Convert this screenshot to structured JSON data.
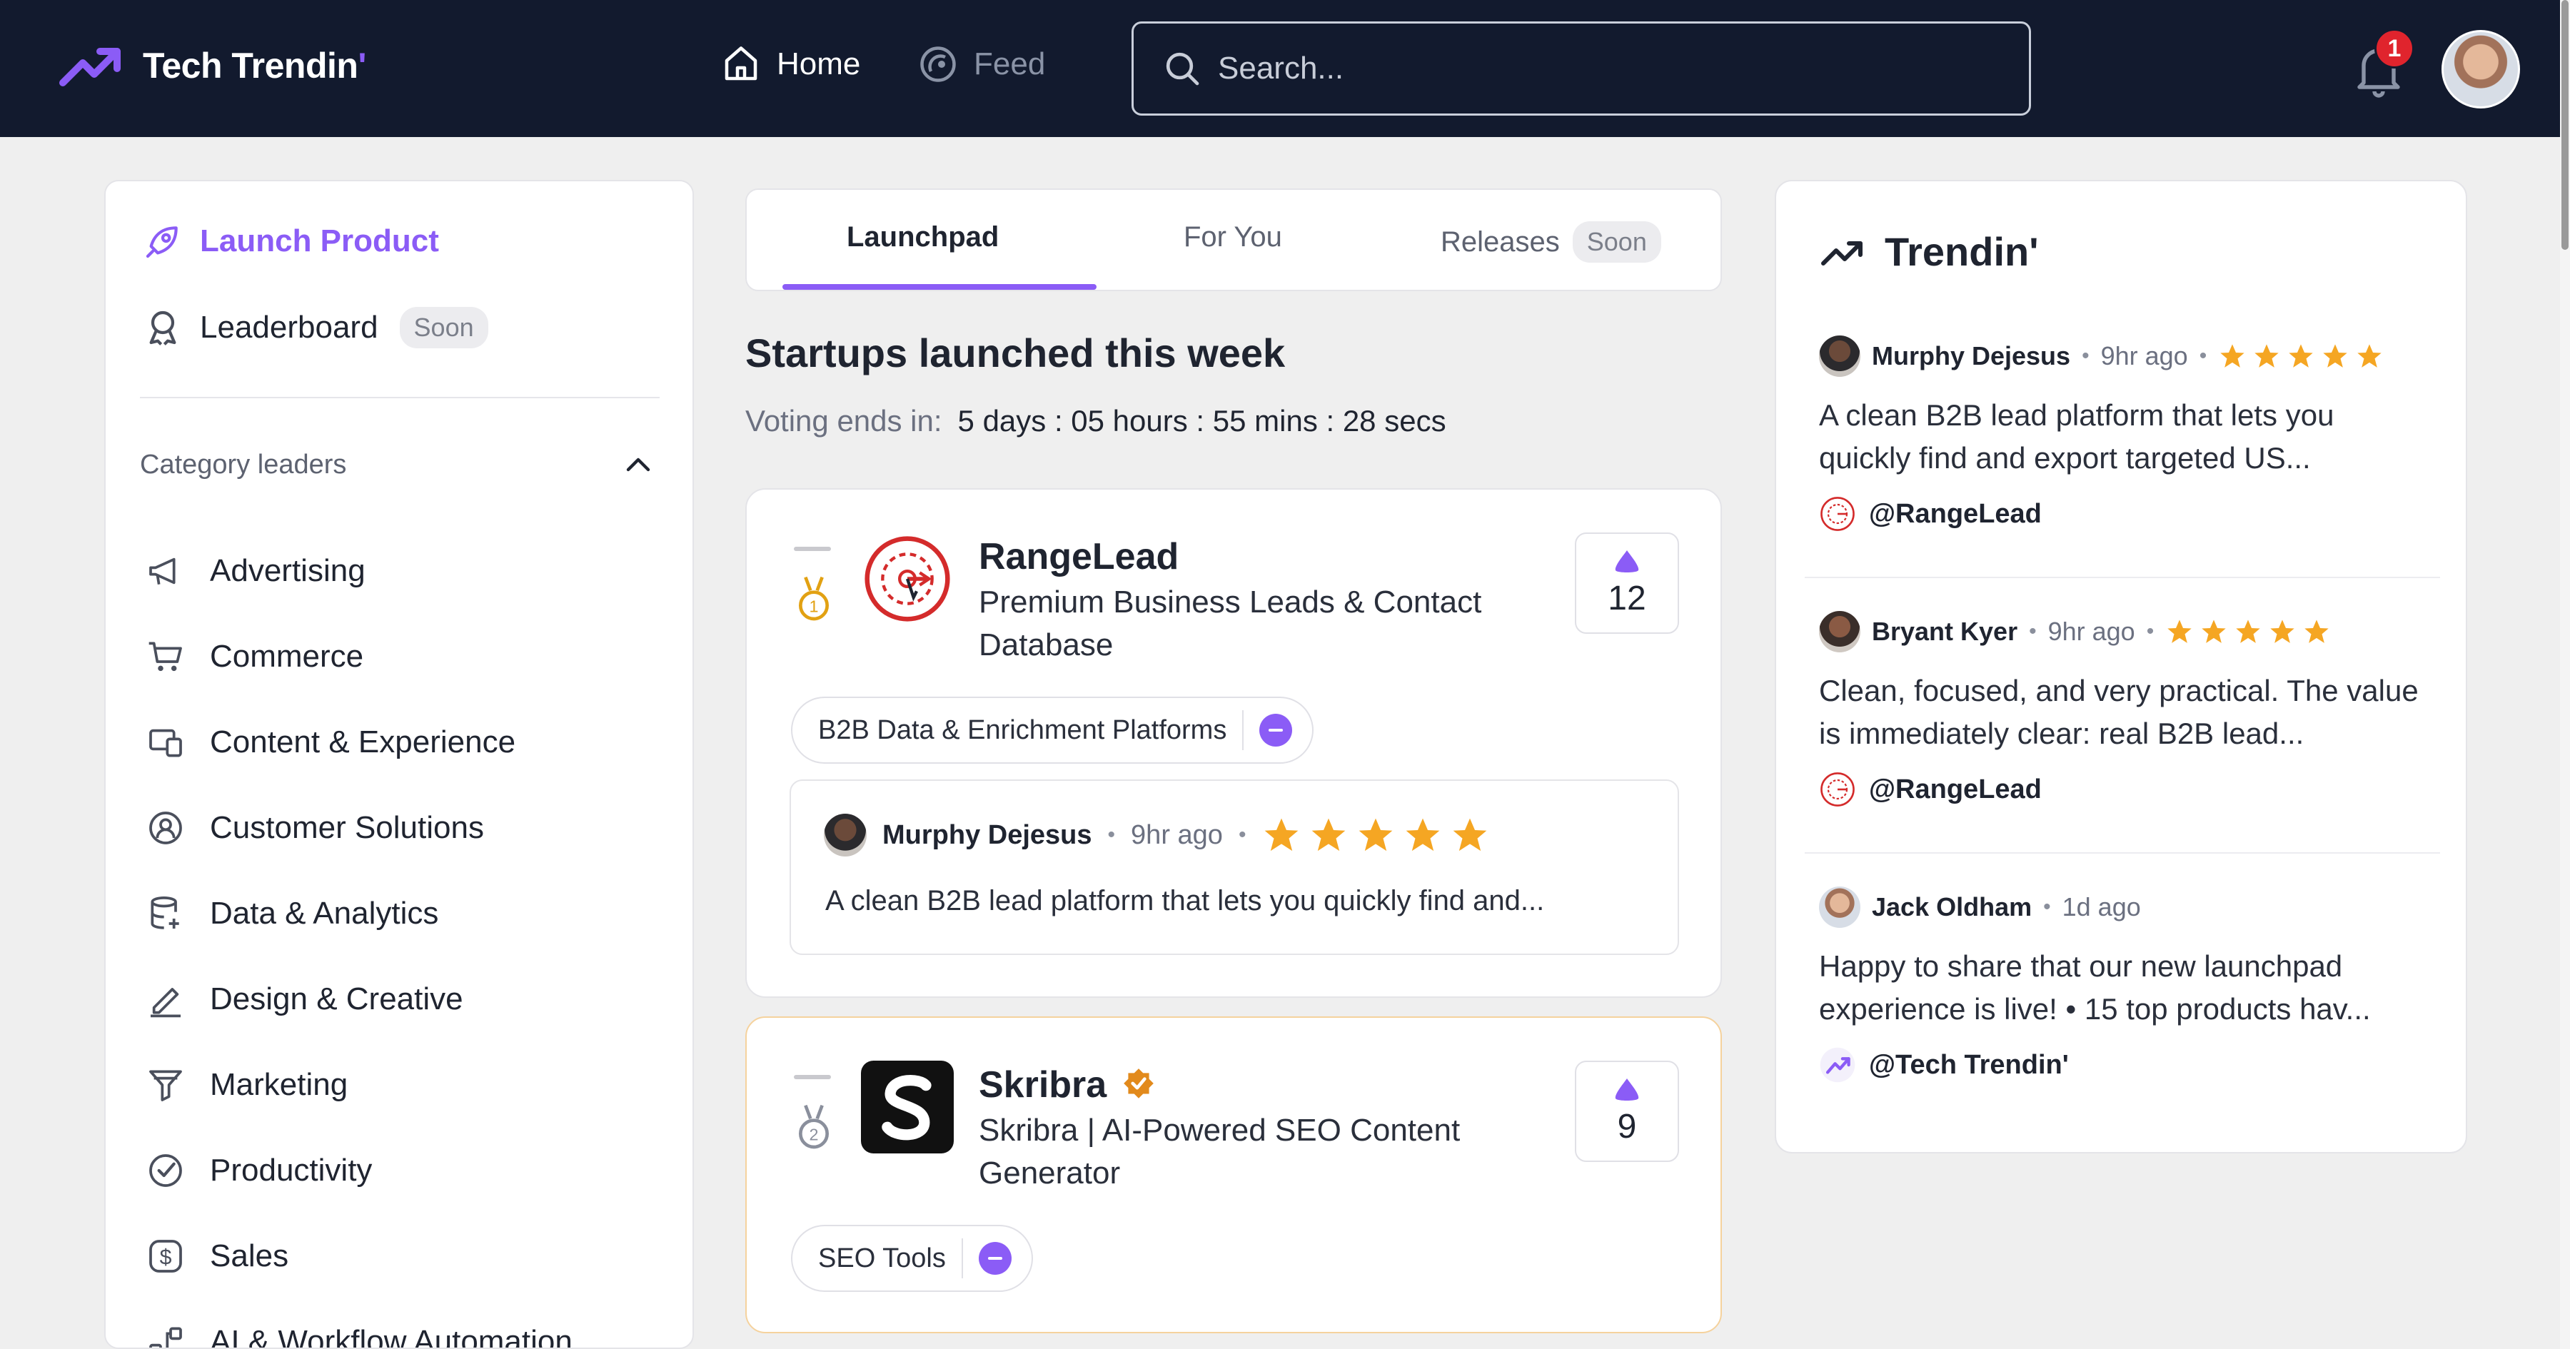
{
  "header": {
    "logo_text": "Tech Trendin",
    "logo_accent": "'",
    "nav": [
      {
        "label": "Home",
        "icon": "home-icon"
      },
      {
        "label": "Feed",
        "icon": "feed-icon"
      }
    ],
    "search_placeholder": "Search...",
    "notification_count": "1"
  },
  "sidebar": {
    "launch_label": "Launch Product",
    "leaderboard_label": "Leaderboard",
    "soon_label": "Soon",
    "categories_title": "Category leaders",
    "categories": [
      {
        "label": "Advertising",
        "icon": "megaphone-icon"
      },
      {
        "label": "Commerce",
        "icon": "cart-icon"
      },
      {
        "label": "Content & Experience",
        "icon": "devices-icon"
      },
      {
        "label": "Customer Solutions",
        "icon": "user-badge-icon"
      },
      {
        "label": "Data & Analytics",
        "icon": "database-icon"
      },
      {
        "label": "Design & Creative",
        "icon": "pencil-icon"
      },
      {
        "label": "Marketing",
        "icon": "funnel-icon"
      },
      {
        "label": "Productivity",
        "icon": "check-circle-icon"
      },
      {
        "label": "Sales",
        "icon": "dollar-icon"
      },
      {
        "label": "AI & Workflow Automation",
        "icon": "workflow-icon"
      }
    ]
  },
  "tabs": {
    "launchpad": "Launchpad",
    "for_you": "For You",
    "releases": "Releases",
    "releases_badge": "Soon"
  },
  "main": {
    "section_title": "Startups launched this week",
    "voting_label": "Voting ends in:",
    "voting_timer": "5 days : 05 hours : 55 mins : 28 secs",
    "products": [
      {
        "name": "RangeLead",
        "tagline": "Premium Business Leads & Contact Database",
        "votes": "12",
        "rank": 1,
        "tag": "B2B Data & Enrichment Platforms",
        "review": {
          "author": "Murphy Dejesus",
          "time": "9hr ago",
          "rating": 5,
          "text": "A clean B2B lead platform that lets you quickly find and..."
        }
      },
      {
        "name": "Skribra",
        "tagline": "Skribra | AI-Powered SEO Content Generator",
        "votes": "9",
        "rank": 2,
        "tag": "SEO Tools",
        "verified": true
      }
    ]
  },
  "trending": {
    "title": "Trendin'",
    "items": [
      {
        "author": "Murphy Dejesus",
        "time": "9hr ago",
        "rating": 5,
        "text": "A clean B2B lead platform that lets you quickly find and export targeted US...",
        "handle": "@RangeLead"
      },
      {
        "author": "Bryant Kyer",
        "time": "9hr ago",
        "rating": 5,
        "text": "Clean, focused, and very practical. The value is immediately clear: real B2B lead...",
        "handle": "@RangeLead"
      },
      {
        "author": "Jack Oldham",
        "time": "1d ago",
        "text": "Happy to share that our new launchpad experience is live! • 15 top products hav...",
        "handle": "@Tech Trendin'"
      }
    ]
  },
  "colors": {
    "header_bg": "#121a2e",
    "accent": "#8b5cf6",
    "star": "#f5a623",
    "badge": "#e0242d",
    "page_bg": "#efefef"
  }
}
